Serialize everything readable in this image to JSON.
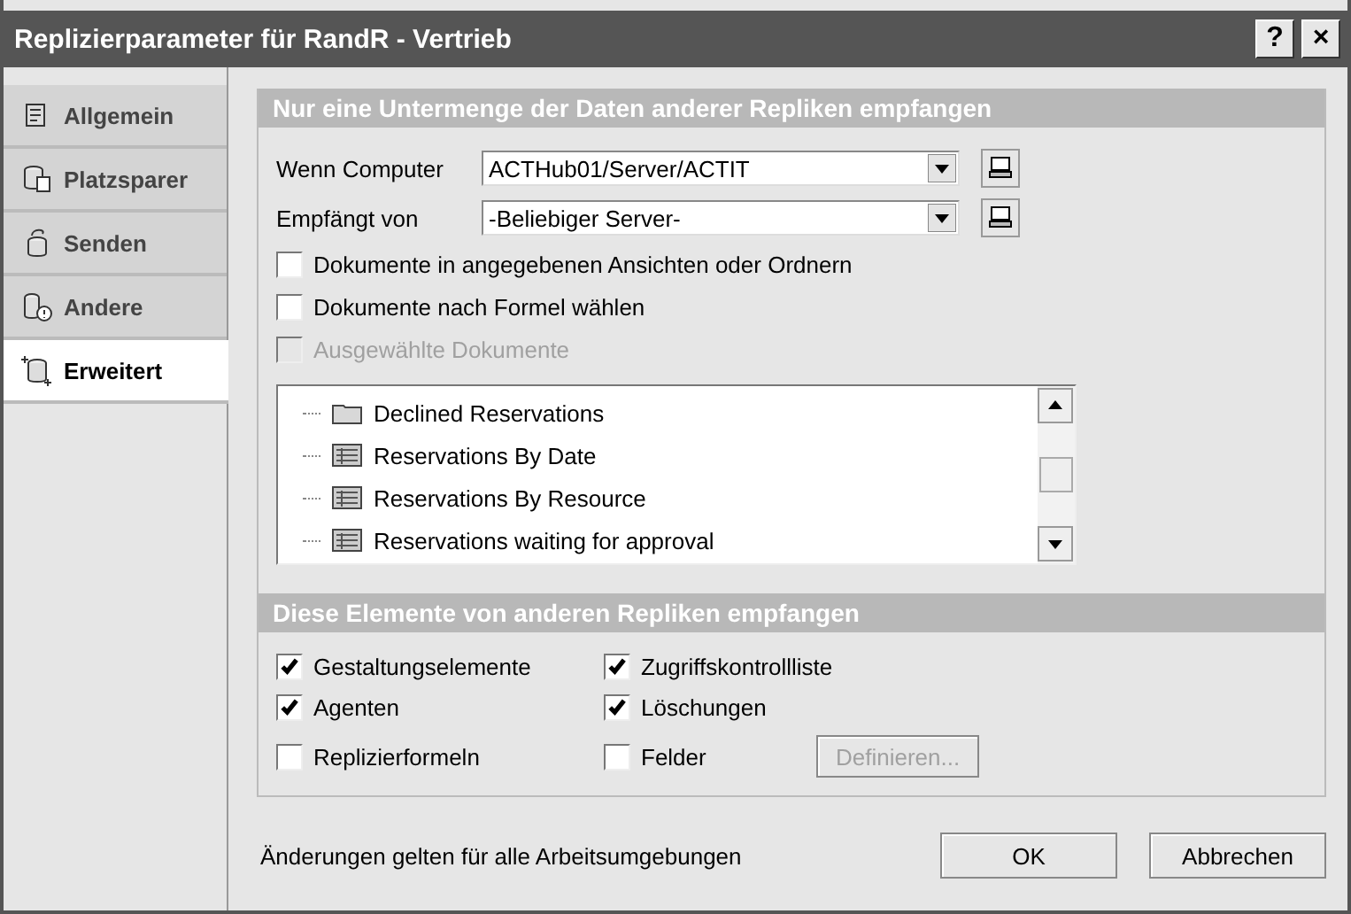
{
  "window": {
    "title": "Replizierparameter für RandR - Vertrieb",
    "help": "?",
    "close": "×"
  },
  "tabs": [
    {
      "label": "Allgemein",
      "kind": "general",
      "selected": false
    },
    {
      "label": "Platzsparer",
      "kind": "space",
      "selected": false
    },
    {
      "label": "Senden",
      "kind": "send",
      "selected": false
    },
    {
      "label": "Andere",
      "kind": "other",
      "selected": false
    },
    {
      "label": "Erweitert",
      "kind": "advanced",
      "selected": true
    }
  ],
  "subset_section": {
    "title": "Nur eine Untermenge der Daten anderer Repliken empfangen",
    "fields": [
      {
        "label": "Wenn Computer",
        "value": "ACTHub01/Server/ACTIT"
      },
      {
        "label": "Empfängt von",
        "value": "-Beliebiger Server-"
      }
    ],
    "options": [
      {
        "label": "Dokumente in angegebenen Ansichten oder Ordnern",
        "checked": false,
        "disabled": false
      },
      {
        "label": "Dokumente nach Formel wählen",
        "checked": false,
        "disabled": false
      },
      {
        "label": "Ausgewählte Dokumente",
        "checked": false,
        "disabled": true
      }
    ],
    "tree": [
      {
        "label": "Declined Reservations",
        "kind": "folder"
      },
      {
        "label": "Reservations By Date",
        "kind": "view"
      },
      {
        "label": "Reservations By Resource",
        "kind": "view"
      },
      {
        "label": "Reservations waiting for approval",
        "kind": "view"
      }
    ]
  },
  "elements_section": {
    "title": "Diese Elemente von anderen Repliken empfangen",
    "items": [
      {
        "label": "Gestaltungselemente",
        "checked": true
      },
      {
        "label": "Zugriffskontrollliste",
        "checked": true
      },
      {
        "label": "Agenten",
        "checked": true
      },
      {
        "label": "Löschungen",
        "checked": true
      },
      {
        "label": "Replizierformeln",
        "checked": false
      },
      {
        "label": "Felder",
        "checked": false
      }
    ],
    "define_button": {
      "label": "Definieren...",
      "disabled": true
    }
  },
  "footer": {
    "note": "Änderungen gelten für alle Arbeitsumgebungen",
    "buttons": [
      "OK",
      "Abbrechen"
    ]
  }
}
